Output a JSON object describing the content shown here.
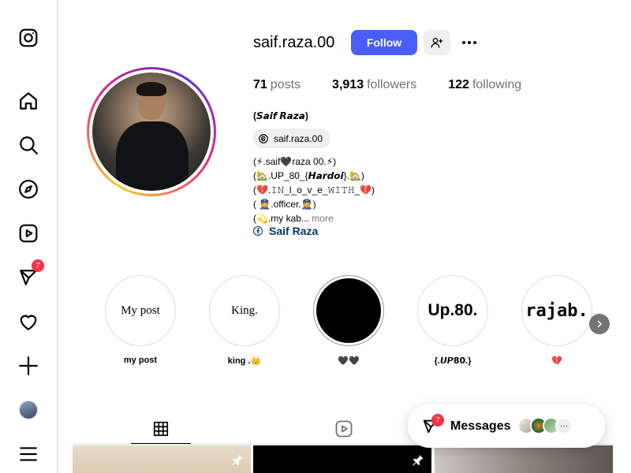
{
  "sidebar": {
    "items": [
      {
        "name": "instagram-logo-icon"
      },
      {
        "name": "home-icon"
      },
      {
        "name": "search-icon"
      },
      {
        "name": "explore-icon"
      },
      {
        "name": "reels-icon"
      },
      {
        "name": "messenger-icon",
        "badge": "7"
      },
      {
        "name": "heart-icon"
      },
      {
        "name": "create-icon"
      },
      {
        "name": "profile-avatar"
      },
      {
        "name": "menu-icon"
      }
    ]
  },
  "profile": {
    "username": "saif.raza.00",
    "follow_label": "Follow",
    "stats": {
      "posts_count": "71",
      "posts_label": "posts",
      "followers_count": "3,913",
      "followers_label": "followers",
      "following_count": "122",
      "following_label": "following"
    },
    "bio_name": "(𝙎𝙖𝙞𝙛 𝙍𝙖𝙯𝙖)",
    "threads_handle": "saif.raza.00",
    "bio_lines": [
      "(⚡.saif🖤raza 00.⚡)",
      "(🏡.UP_80_{𝙃𝙖𝙧𝙙𝙤𝙞}.🏡)",
      "(💔.𝙸𝙽_l_o_v_e_𝚆𝙸𝚃𝙷_💔)",
      "( 👮.officer.👮)",
      "(💫.my kab..."
    ],
    "more_label": "more",
    "facebook_name": "Saif Raza"
  },
  "highlights": [
    {
      "title": "my post",
      "cover_text": "My post"
    },
    {
      "title": "king .👑",
      "cover_text": "King."
    },
    {
      "title": "🖤🖤",
      "cover_text": ""
    },
    {
      "title": "{.𝙐𝙋𝟴𝟬.}",
      "cover_text": "Up.80."
    },
    {
      "title": "💔",
      "cover_text": "rajab."
    }
  ],
  "messages": {
    "label": "Messages",
    "badge": "7"
  },
  "colors": {
    "follow_button": "#4a5df9",
    "badge": "#ff3040",
    "link": "#00376b"
  }
}
